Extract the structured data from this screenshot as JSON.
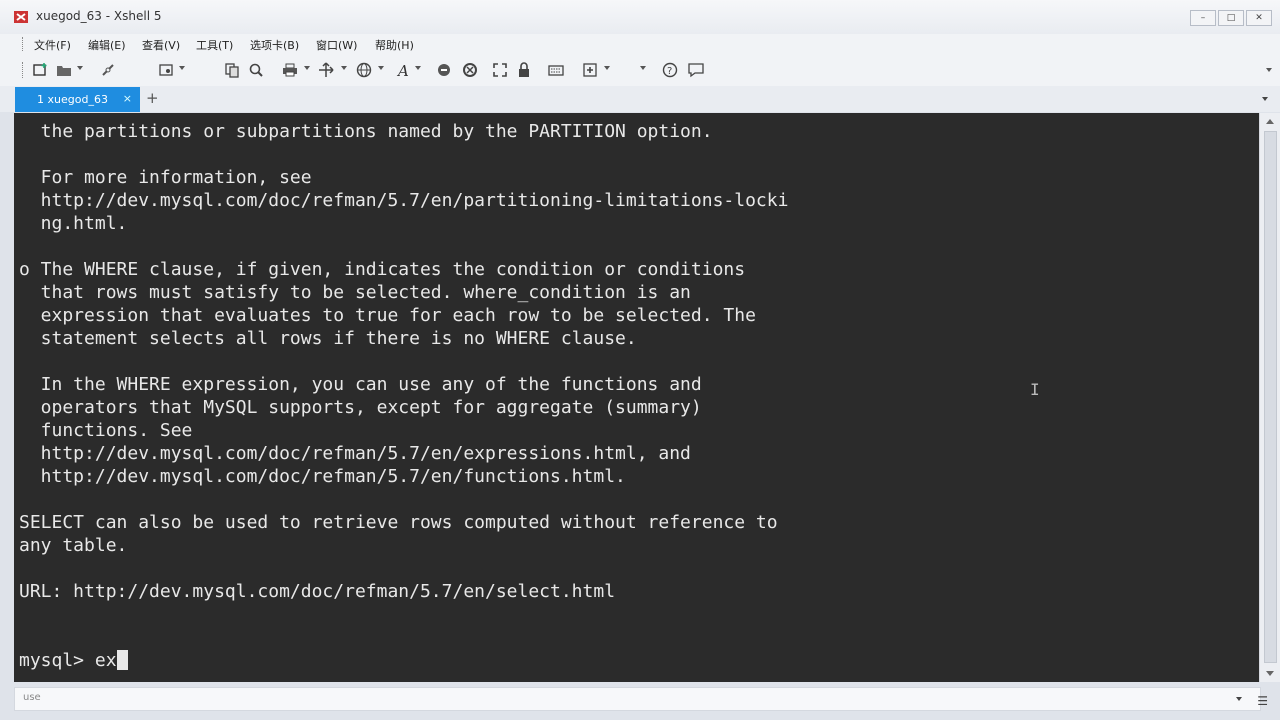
{
  "window": {
    "title": "xuegod_63 - Xshell 5"
  },
  "menu": [
    "文件(F)",
    "编辑(E)",
    "查看(V)",
    "工具(T)",
    "选项卡(B)",
    "窗口(W)",
    "帮助(H)"
  ],
  "tabs": {
    "active": {
      "label": "1 xuegod_63",
      "close": "×"
    },
    "add": "+"
  },
  "terminal": {
    "lines": [
      "  the partitions or subpartitions named by the PARTITION option.",
      "",
      "  For more information, see",
      "  http://dev.mysql.com/doc/refman/5.7/en/partitioning-limitations-locki",
      "  ng.html.",
      "",
      "o The WHERE clause, if given, indicates the condition or conditions",
      "  that rows must satisfy to be selected. where_condition is an",
      "  expression that evaluates to true for each row to be selected. The",
      "  statement selects all rows if there is no WHERE clause.",
      "",
      "  In the WHERE expression, you can use any of the functions and",
      "  operators that MySQL supports, except for aggregate (summary)",
      "  functions. See",
      "  http://dev.mysql.com/doc/refman/5.7/en/expressions.html, and",
      "  http://dev.mysql.com/doc/refman/5.7/en/functions.html.",
      "",
      "SELECT can also be used to retrieve rows computed without reference to",
      "any table.",
      "",
      "URL: http://dev.mysql.com/doc/refman/5.7/en/select.html"
    ],
    "prompt": "mysql> ",
    "input": "ex"
  },
  "compose": {
    "placeholder": "use"
  },
  "colors": {
    "tab_active": "#1f8de0",
    "terminal_bg": "#2b2b2b",
    "terminal_fg": "#e8e8e8"
  },
  "icons": [
    "new-session-icon",
    "open-folder-icon",
    "disconnect-icon",
    "properties-icon",
    "copy-icon",
    "find-icon",
    "print-icon",
    "transfer-icon",
    "globe-icon",
    "font-icon",
    "xftp-icon",
    "xmanager-icon",
    "fullscreen-icon",
    "lock-icon",
    "keyboard-icon",
    "add-script-icon",
    "help-icon",
    "chat-icon"
  ]
}
